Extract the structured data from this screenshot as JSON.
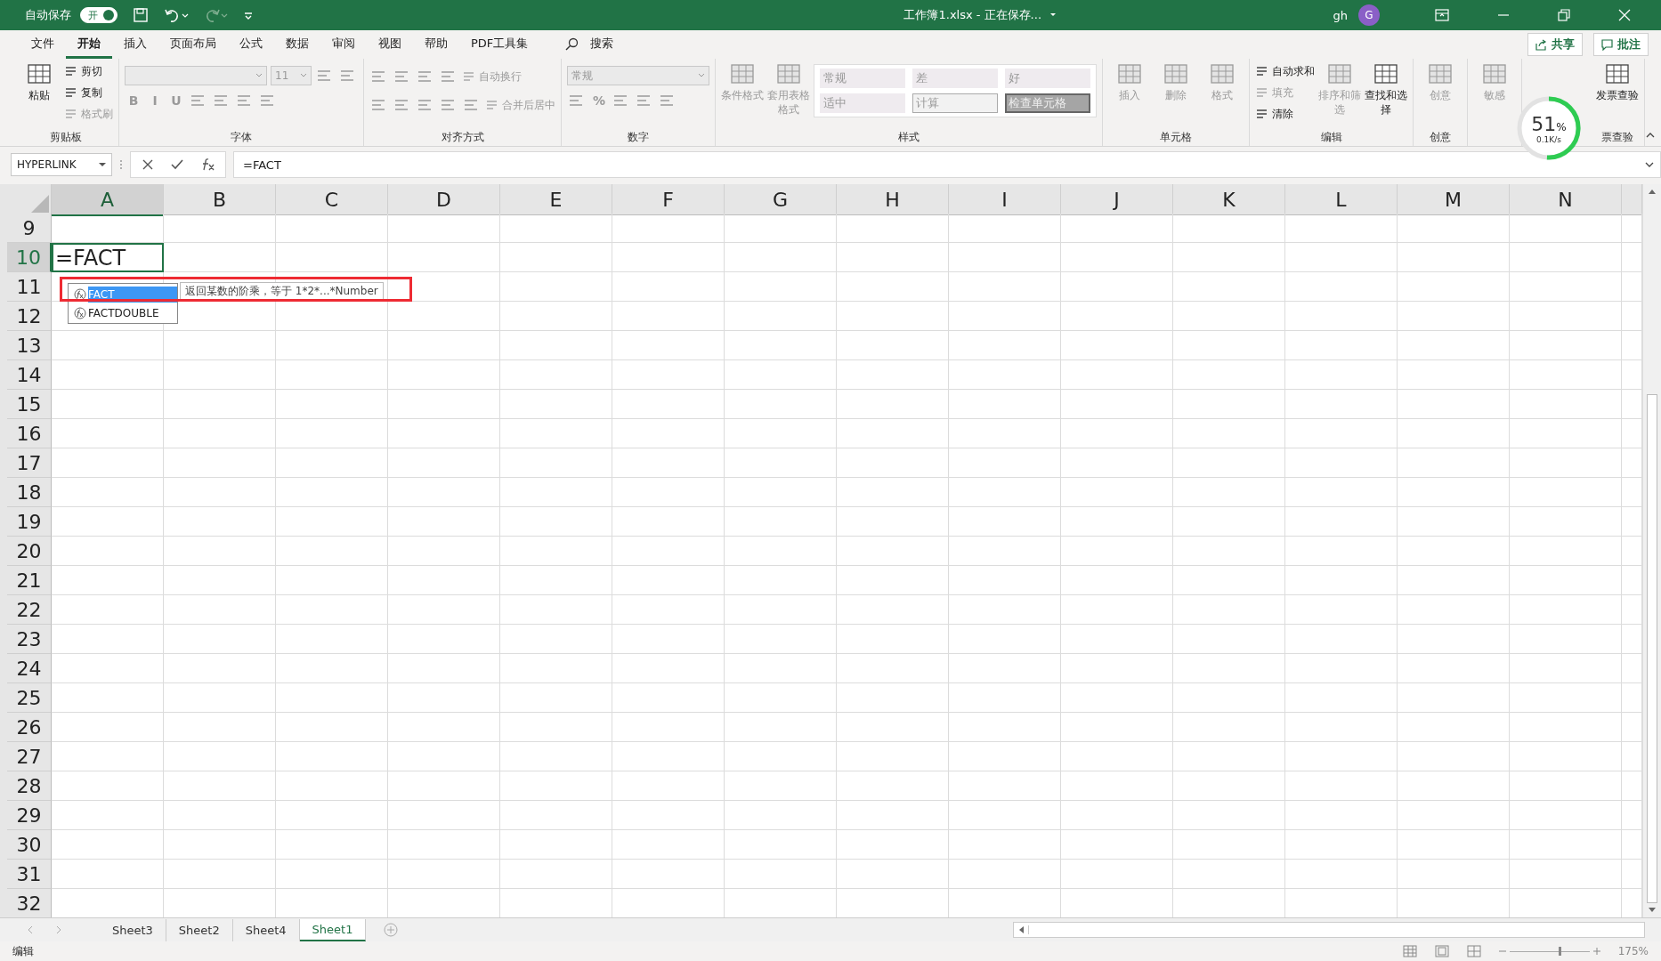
{
  "title_bar": {
    "autosave_label": "自动保存",
    "autosave_state": "开",
    "autosave_on": true,
    "title": "工作簿1.xlsx - 正在保存...",
    "user": "gh",
    "avatar": "G"
  },
  "menu_tabs": [
    {
      "label": "文件",
      "selected": false
    },
    {
      "label": "开始",
      "selected": true
    },
    {
      "label": "插入",
      "selected": false
    },
    {
      "label": "页面布局",
      "selected": false
    },
    {
      "label": "公式",
      "selected": false
    },
    {
      "label": "数据",
      "selected": false
    },
    {
      "label": "审阅",
      "selected": false
    },
    {
      "label": "视图",
      "selected": false
    },
    {
      "label": "帮助",
      "selected": false
    },
    {
      "label": "PDF工具集",
      "selected": false
    }
  ],
  "search": "搜索",
  "share": "共享",
  "comment": "批注",
  "ribbon_groups": [
    {
      "name": "剪贴板",
      "columns": [
        [
          {
            "kind": "large",
            "label": "粘贴",
            "disabled": false
          }
        ],
        [
          {
            "kind": "small",
            "label": "剪切",
            "disabled": false
          },
          {
            "kind": "small",
            "label": "复制",
            "disabled": false
          },
          {
            "kind": "small",
            "label": "格式刷",
            "disabled": true
          }
        ]
      ]
    },
    {
      "name": "字体",
      "rows": [
        [
          {
            "kind": "fontbox",
            "disabled": true
          },
          {
            "kind": "select",
            "label": "11",
            "disabled": true
          },
          {
            "kind": "icon",
            "disabled": true
          },
          {
            "kind": "icon",
            "disabled": true
          }
        ],
        [
          {
            "kind": "glyph",
            "label": "B",
            "disabled": true
          },
          {
            "kind": "glyph",
            "label": "I",
            "disabled": true
          },
          {
            "kind": "glyph",
            "label": "U",
            "disabled": true
          },
          {
            "kind": "icon",
            "disabled": true
          },
          {
            "kind": "icon",
            "disabled": true
          },
          {
            "kind": "icon",
            "disabled": true
          },
          {
            "kind": "icon",
            "disabled": true
          }
        ]
      ]
    },
    {
      "name": "对齐方式",
      "rows": [
        [
          {
            "kind": "icon",
            "disabled": true
          },
          {
            "kind": "icon",
            "disabled": true
          },
          {
            "kind": "icon",
            "disabled": true
          },
          {
            "kind": "icon",
            "disabled": true
          },
          {
            "kind": "small",
            "label": "自动换行",
            "disabled": true
          }
        ],
        [
          {
            "kind": "icon",
            "disabled": true
          },
          {
            "kind": "icon",
            "disabled": true
          },
          {
            "kind": "icon",
            "disabled": true
          },
          {
            "kind": "icon",
            "disabled": true
          },
          {
            "kind": "icon",
            "disabled": true
          },
          {
            "kind": "small",
            "label": "合并后居中",
            "disabled": true
          }
        ]
      ]
    },
    {
      "name": "数字",
      "rows": [
        [
          {
            "kind": "fontbox",
            "label": "常规",
            "disabled": true
          }
        ],
        [
          {
            "kind": "icon",
            "disabled": true
          },
          {
            "kind": "glyph",
            "label": "%",
            "disabled": true
          },
          {
            "kind": "icon",
            "disabled": true
          },
          {
            "kind": "icon",
            "disabled": true
          },
          {
            "kind": "icon",
            "disabled": true
          }
        ]
      ]
    },
    {
      "name": "样式",
      "columns": [
        [
          {
            "kind": "large",
            "label": "条件格式",
            "disabled": true
          }
        ],
        [
          {
            "kind": "large",
            "label": "套用表格格式",
            "disabled": true
          }
        ]
      ],
      "styles": [
        {
          "label": "常规",
          "kind": "plain"
        },
        {
          "label": "差",
          "kind": "plain"
        },
        {
          "label": "好",
          "kind": "plain"
        },
        {
          "label": "适中",
          "kind": "plain"
        },
        {
          "label": "计算",
          "kind": "outlined"
        },
        {
          "label": "检查单元格",
          "kind": "dark"
        }
      ]
    },
    {
      "name": "单元格",
      "columns": [
        [
          {
            "kind": "large",
            "label": "插入",
            "disabled": true
          }
        ],
        [
          {
            "kind": "large",
            "label": "删除",
            "disabled": true
          }
        ],
        [
          {
            "kind": "large",
            "label": "格式",
            "disabled": true
          }
        ]
      ]
    },
    {
      "name": "编辑",
      "columns": [
        [
          {
            "kind": "small",
            "label": "自动求和",
            "disabled": false
          },
          {
            "kind": "small",
            "label": "填充",
            "disabled": true
          },
          {
            "kind": "small",
            "label": "清除",
            "disabled": false
          }
        ],
        [
          {
            "kind": "large",
            "label": "排序和筛选",
            "disabled": true
          }
        ],
        [
          {
            "kind": "large",
            "label": "查找和选择",
            "disabled": false
          }
        ]
      ]
    },
    {
      "name": "创意",
      "columns": [
        [
          {
            "kind": "large",
            "label": "创意",
            "disabled": true
          }
        ]
      ]
    },
    {
      "columns": [
        [
          {
            "kind": "large",
            "label": "敏感",
            "disabled": true
          }
        ]
      ]
    },
    {
      "name": "票查验",
      "columns": [
        [
          {
            "kind": "large",
            "label": "发票查验",
            "disabled": false
          }
        ]
      ]
    }
  ],
  "name_box": "HYPERLINK",
  "formula": "=FACT",
  "columns": [
    {
      "label": "A",
      "selected": true
    },
    {
      "label": "B",
      "selected": false
    },
    {
      "label": "C",
      "selected": false
    },
    {
      "label": "D",
      "selected": false
    },
    {
      "label": "E",
      "selected": false
    },
    {
      "label": "F",
      "selected": false
    },
    {
      "label": "G",
      "selected": false
    },
    {
      "label": "H",
      "selected": false
    },
    {
      "label": "I",
      "selected": false
    },
    {
      "label": "J",
      "selected": false
    },
    {
      "label": "K",
      "selected": false
    },
    {
      "label": "L",
      "selected": false
    },
    {
      "label": "M",
      "selected": false
    },
    {
      "label": "N",
      "selected": false
    }
  ],
  "rows": [
    {
      "number": "9",
      "selected": false
    },
    {
      "number": "10",
      "selected": true,
      "cell_a": "=FACT"
    },
    {
      "number": "11",
      "selected": false
    },
    {
      "number": "12",
      "selected": false
    },
    {
      "number": "13",
      "selected": false
    },
    {
      "number": "14",
      "selected": false
    },
    {
      "number": "15",
      "selected": false
    },
    {
      "number": "16",
      "selected": false
    },
    {
      "number": "17",
      "selected": false
    },
    {
      "number": "18",
      "selected": false
    },
    {
      "number": "19",
      "selected": false
    },
    {
      "number": "20",
      "selected": false
    },
    {
      "number": "21",
      "selected": false
    },
    {
      "number": "22",
      "selected": false
    },
    {
      "number": "23",
      "selected": false
    },
    {
      "number": "24",
      "selected": false
    },
    {
      "number": "25",
      "selected": false
    },
    {
      "number": "26",
      "selected": false
    },
    {
      "number": "27",
      "selected": false
    },
    {
      "number": "28",
      "selected": false
    },
    {
      "number": "29",
      "selected": false
    },
    {
      "number": "30",
      "selected": false
    },
    {
      "number": "31",
      "selected": false
    },
    {
      "number": "32",
      "selected": false
    }
  ],
  "autocomplete": [
    {
      "label": "FACT",
      "selected": true
    },
    {
      "label": "FACTDOUBLE",
      "selected": false
    }
  ],
  "tooltip": "返回某数的阶乘，等于 1*2*...*Number",
  "sheets": [
    {
      "label": "Sheet3",
      "selected": false
    },
    {
      "label": "Sheet2",
      "selected": false
    },
    {
      "label": "Sheet4",
      "selected": false
    },
    {
      "label": "Sheet1",
      "selected": true
    }
  ],
  "status": "编辑",
  "zoom": "175%",
  "zoom_slider": {
    "level": 0.62
  },
  "speed_meter": {
    "percent": "51",
    "unit": "%",
    "rate": "0.1K/s",
    "level": 0.51
  }
}
